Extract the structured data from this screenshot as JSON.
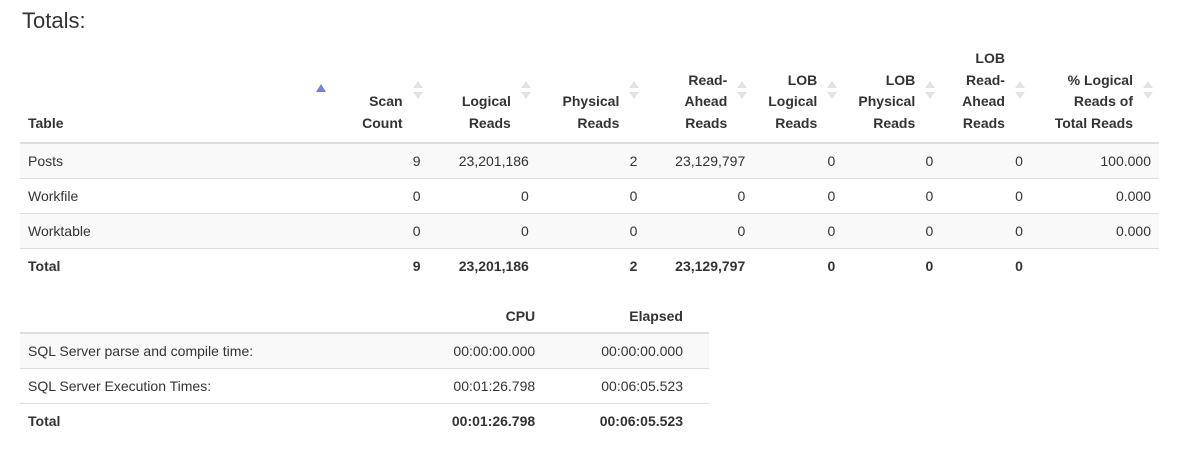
{
  "title": "Totals:",
  "colors": {
    "sort_active": "#7b7fd0",
    "sort_inactive": "#e3e3e3",
    "border": "#dddddd",
    "stripe": "#f9f9f9"
  },
  "stats_table": {
    "headers": [
      {
        "label": "Table",
        "sortable": true,
        "sorted": "asc"
      },
      {
        "label": "Scan Count",
        "sortable": true
      },
      {
        "label": "Logical Reads",
        "sortable": true
      },
      {
        "label": "Physical Reads",
        "sortable": true
      },
      {
        "label": "Read-Ahead Reads",
        "sortable": true
      },
      {
        "label": "LOB Logical Reads",
        "sortable": true
      },
      {
        "label": "LOB Physical Reads",
        "sortable": true
      },
      {
        "label": "LOB Read-Ahead Reads",
        "sortable": true
      },
      {
        "label": "% Logical Reads of Total Reads",
        "sortable": true
      }
    ],
    "rows": [
      [
        "Posts",
        "9",
        "23,201,186",
        "2",
        "23,129,797",
        "0",
        "0",
        "0",
        "100.000"
      ],
      [
        "Workfile",
        "0",
        "0",
        "0",
        "0",
        "0",
        "0",
        "0",
        "0.000"
      ],
      [
        "Worktable",
        "0",
        "0",
        "0",
        "0",
        "0",
        "0",
        "0",
        "0.000"
      ]
    ],
    "total": [
      "Total",
      "9",
      "23,201,186",
      "2",
      "23,129,797",
      "0",
      "0",
      "0",
      ""
    ]
  },
  "time_table": {
    "headers": [
      "",
      "CPU",
      "Elapsed"
    ],
    "rows": [
      [
        "SQL Server parse and compile time:",
        "00:00:00.000",
        "00:00:00.000"
      ],
      [
        "SQL Server Execution Times:",
        "00:01:26.798",
        "00:06:05.523"
      ]
    ],
    "total": [
      "Total",
      "00:01:26.798",
      "00:06:05.523"
    ]
  }
}
